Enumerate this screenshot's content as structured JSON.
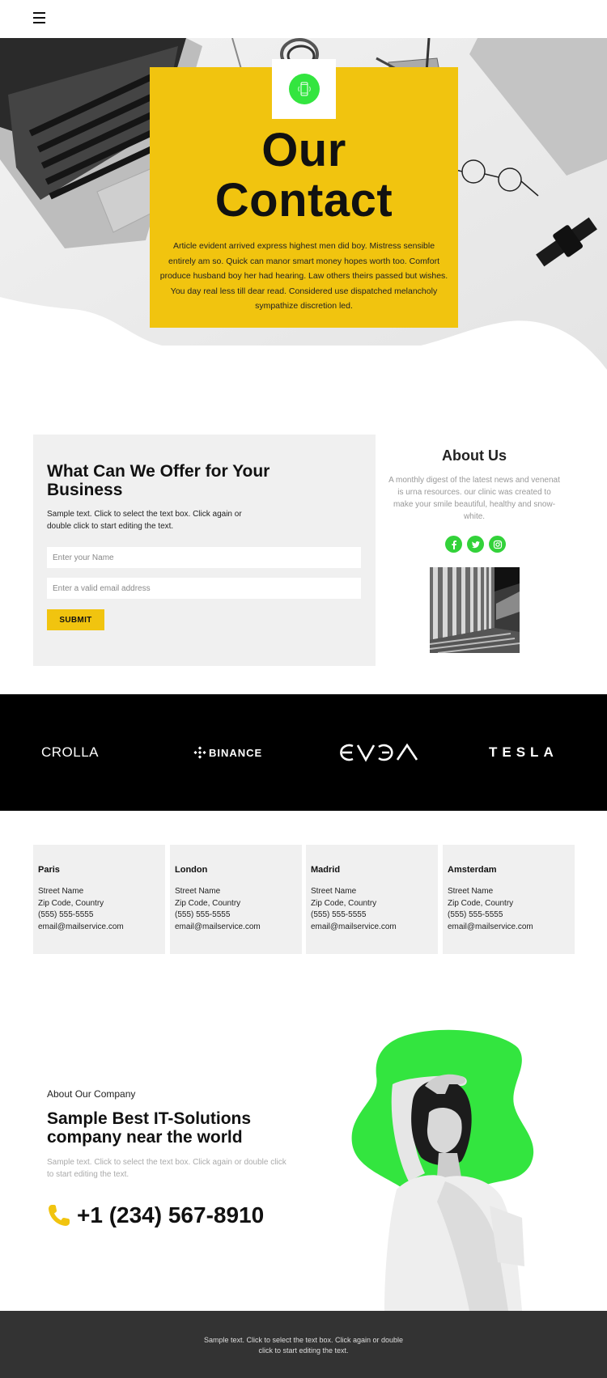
{
  "header": {
    "menu_icon": "hamburger-menu-icon"
  },
  "hero": {
    "icon": "smartphone-vibrate-icon",
    "title_line1": "Our",
    "title_line2": "Contact",
    "text": "Article evident arrived express highest men did boy. Mistress sensible entirely am so. Quick can manor smart money hopes worth too. Comfort produce husband boy her had hearing. Law others theirs passed but wishes. You day real less till dear read. Considered use dispatched melancholy sympathize discretion led.",
    "accent_color": "#f1c40f",
    "icon_color": "#33e53f"
  },
  "offer": {
    "title": "What Can We Offer for Your Business",
    "text": "Sample text. Click to select the text box. Click again or double click to start editing the text.",
    "name_placeholder": "Enter your Name",
    "email_placeholder": "Enter a valid email address",
    "name_value": "",
    "email_value": "",
    "submit_label": "SUBMIT"
  },
  "about": {
    "title": "About Us",
    "text": "A monthly digest of the latest news and venenat is urna resources. our clinic was created to make your smile beautiful, healthy and snow-white.",
    "socials": [
      {
        "name": "facebook-icon",
        "glyph": "f"
      },
      {
        "name": "twitter-icon",
        "glyph": "t"
      },
      {
        "name": "instagram-icon",
        "glyph": "ig"
      }
    ],
    "social_color": "#33d23a"
  },
  "logos": [
    {
      "name": "CROLLA"
    },
    {
      "name": "BINANCE"
    },
    {
      "name": "EVGA"
    },
    {
      "name": "TESLA"
    }
  ],
  "locations": [
    {
      "city": "Paris",
      "street": "Street Name",
      "zip": "Zip Code, Country",
      "phone": "(555) 555-5555",
      "email": "email@mailservice.com"
    },
    {
      "city": "London",
      "street": "Street Name",
      "zip": "Zip Code, Country",
      "phone": "(555) 555-5555",
      "email": "email@mailservice.com"
    },
    {
      "city": "Madrid",
      "street": "Street Name",
      "zip": "Zip Code, Country",
      "phone": "(555) 555-5555",
      "email": "email@mailservice.com"
    },
    {
      "city": "Amsterdam",
      "street": "Street Name",
      "zip": "Zip Code, Country",
      "phone": "(555) 555-5555",
      "email": "email@mailservice.com"
    }
  ],
  "company": {
    "label": "About Our Company",
    "title": "Sample Best IT-Solutions company near the world",
    "text": "Sample text. Click to select the text box. Click again or double click to start editing the text.",
    "phone": "+1 (234) 567-8910",
    "phone_icon": "phone-icon",
    "blob_color": "#33e53f"
  },
  "footer": {
    "text": "Sample text. Click to select the text box. Click again or double click to start editing the text."
  }
}
